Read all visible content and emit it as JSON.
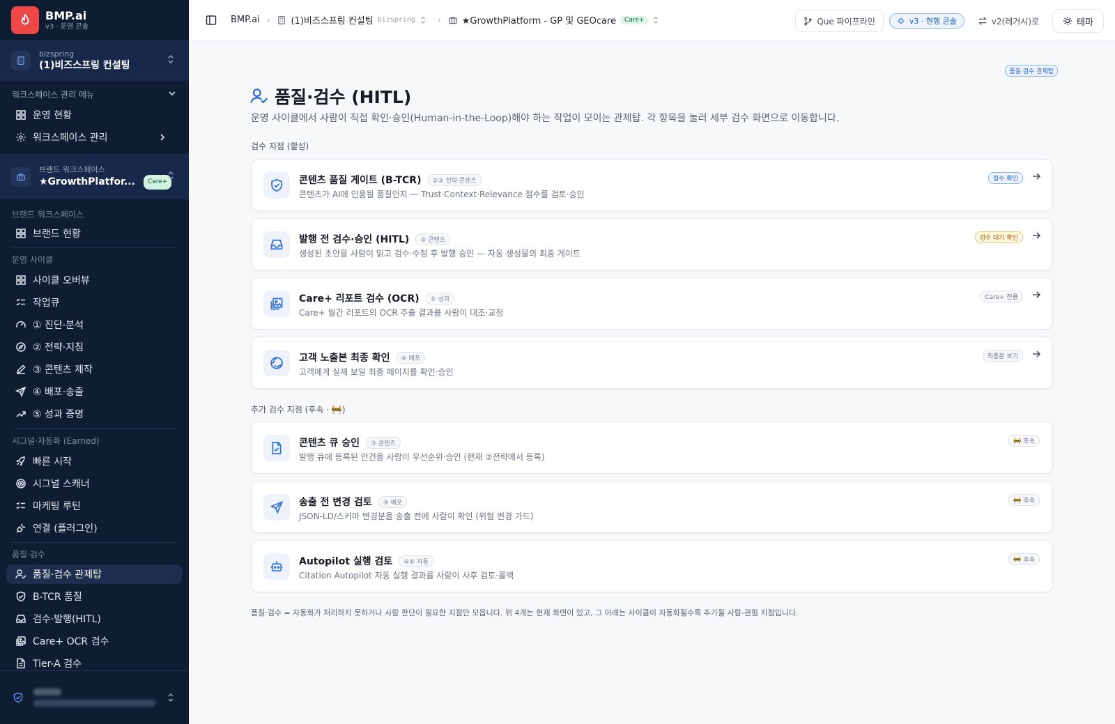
{
  "app": {
    "name": "BMP.ai",
    "subtitle": "v3 · 운영 콘솔",
    "brand_color": "#ef4646"
  },
  "org_switcher": {
    "small": "bizspring",
    "name": "(1)비즈스프링 컨설팅"
  },
  "workspace_menu": {
    "heading": "워크스페이스 관리 메뉴",
    "items": [
      {
        "label": "운영 현황",
        "icon": "grid-icon"
      },
      {
        "label": "워크스페이스 관리",
        "icon": "gear-icon"
      }
    ]
  },
  "brand_switcher": {
    "small": "브랜드 워크스페이스",
    "name": "★GrowthPlatfor...",
    "badge": "Care+"
  },
  "sections": {
    "brand": {
      "label": "브랜드 워크스페이스",
      "items": [
        "브랜드 현황"
      ]
    },
    "cycle": {
      "label": "운영 사이클",
      "items": [
        "사이클 오버뷰",
        "작업큐",
        "① 진단·분석",
        "② 전략·지침",
        "③ 콘텐츠 제작",
        "④ 배포·송출",
        "⑤ 성과 증명"
      ]
    },
    "signal": {
      "label": "시그널·자동화 (Earned)",
      "items": [
        "빠른 시작",
        "시그널 스캐너",
        "마케팅 루틴",
        "연결 (플러그인)"
      ]
    },
    "quality": {
      "label": "품질·검수",
      "items": [
        "품질·검수 관제탑",
        "B-TCR 품질",
        "검수·발행(HITL)",
        "Care+ OCR 검수",
        "Tier-A 검수"
      ]
    }
  },
  "breadcrumb": {
    "root": "BMP.ai",
    "org": "(1)비즈스프링 컨설팅",
    "org_code": "bizspring",
    "brand": "★GrowthPlatform - GP 및 GEOcare",
    "brand_badge": "Care+"
  },
  "topbar": {
    "pipeline": "Que 파이프라인",
    "v3": "v3 · 현행 콘솔",
    "v2": "v2(레거시)로",
    "theme": "테마"
  },
  "page": {
    "corner_badge": "품질·검수 관제탑",
    "title": "품질·검수 (HITL)",
    "description": "운영 사이클에서 사람이 직접 확인·승인(Human-in-the-Loop)해야 하는 작업이 모이는 관제탑. 각 항목을 눌러 세부 검수 화면으로 이동합니다.",
    "active_label": "검수 지점 (활성)",
    "later_label": "추가 검수 지점 (후속 · 🚧)",
    "footnote": "품질·검수 = 자동화가 처리하지 못하거나 사람 판단이 필요한 지점만 모읍니다. 위 4개는 현재 화면이 있고, 그 아래는 사이클이 자동화될수록 추가될 사람-권펌 지점입니다."
  },
  "active_points": [
    {
      "title": "콘텐츠 품질 게이트 (B-TCR)",
      "tag": "②③ 전략·콘텐츠",
      "desc": "콘텐츠가 AI에 인용될 품질인지 — Trust·Context·Relevance 점수를 검토·승인",
      "status": "점수 확인",
      "icon": "shield-check-icon"
    },
    {
      "title": "발행 전 검수·승인 (HITL)",
      "tag": "③ 콘텐츠",
      "desc": "생성된 초안을 사람이 읽고 검수·수정 후 발행 승인 — 자동 생성물의 최종 게이트",
      "status": "검수 대기 확인",
      "icon": "inbox-icon"
    },
    {
      "title": "Care+ 리포트 검수 (OCR)",
      "tag": "⑤ 성과",
      "desc": "Care+ 월간 리포트의 OCR 추출 결과를 사람이 대조·교정",
      "status": "Care+ 전용",
      "icon": "images-icon"
    },
    {
      "title": "고객 노출본 최종 확인",
      "tag": "④ 배포",
      "desc": "고객에게 실제 보일 최종 페이지를 확인·승인",
      "status": "최종본 보기",
      "icon": "globe-icon"
    }
  ],
  "later_points": [
    {
      "title": "콘텐츠 큐 승인",
      "tag": "③ 콘텐츠",
      "desc": "발행 큐에 등록된 안건을 사람이 우선순위·승인 (현재 ②전략에서 등록)",
      "status": "🚧 후속",
      "icon": "clipboard-check-icon"
    },
    {
      "title": "송출 전 변경 검토",
      "tag": "④ 배포",
      "desc": "JSON-LD/스키마 변경분을 송출 전에 사람이 확인 (위험 변경 가드)",
      "status": "🚧 후속",
      "icon": "send-icon"
    },
    {
      "title": "Autopilot 실행 검토",
      "tag": "⑥⑥ 자동",
      "desc": "Citation Autopilot 자동 실행 결과를 사람이 사후 검토·롤백",
      "status": "🚧 후속",
      "icon": "bot-icon"
    }
  ]
}
